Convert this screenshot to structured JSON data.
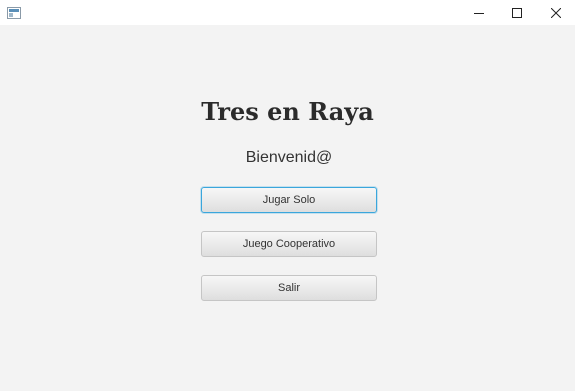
{
  "window": {
    "controls": {
      "minimize": "minimize-icon",
      "maximize": "maximize-icon",
      "close": "close-icon"
    }
  },
  "main": {
    "title": "Tres en Raya",
    "welcome": "Bienvenid@",
    "buttons": {
      "solo": "Jugar Solo",
      "coop": "Juego Cooperativo",
      "exit": "Salir"
    }
  },
  "colors": {
    "focus_accent": "#3aa6dc",
    "background": "#f3f3f3"
  }
}
